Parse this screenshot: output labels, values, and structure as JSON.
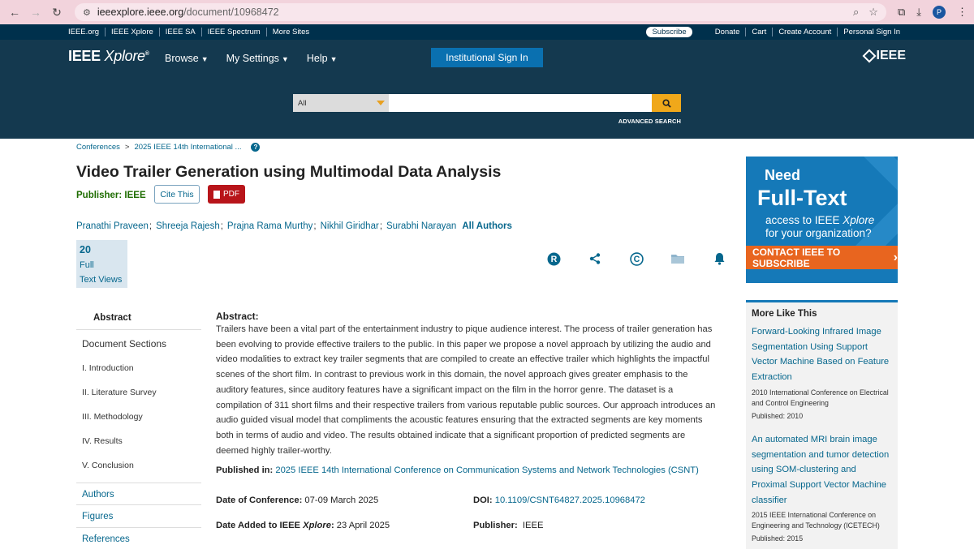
{
  "browser": {
    "url_host": "ieeexplore.ieee.org",
    "url_path": "/document/10968472",
    "profile_initial": "P"
  },
  "meta_bar": {
    "left_links": [
      "IEEE.org",
      "IEEE Xplore",
      "IEEE SA",
      "IEEE Spectrum",
      "More Sites"
    ],
    "subscribe": "Subscribe",
    "right_links": [
      "Donate",
      "Cart",
      "Create Account",
      "Personal Sign In"
    ]
  },
  "header": {
    "logo_ieee": "IEEE",
    "logo_xplore": "Xplore",
    "logo_mark": "®",
    "nav": [
      "Browse",
      "My Settings",
      "Help"
    ],
    "institutional_sign_in": "Institutional Sign In",
    "ieee_mark": "IEEE",
    "search_scope": "All",
    "search_placeholder": "",
    "advanced_search": "ADVANCED SEARCH"
  },
  "breadcrumb": [
    "Conferences",
    "2025 IEEE 14th International ..."
  ],
  "breadcrumb_sep": ">",
  "article": {
    "title": "Video Trailer Generation using Multimodal Data Analysis",
    "publisher_label": "Publisher:  IEEE",
    "cite_this": "Cite This",
    "pdf": "PDF",
    "authors": [
      "Pranathi Praveen",
      "Shreeja Rajesh",
      "Prajna Rama Murthy",
      "Nikhil Giridhar",
      "Surabhi Narayan"
    ],
    "author_sep": ";",
    "all_authors": "All Authors",
    "metrics_count": "20",
    "metrics_label_1": "Full",
    "metrics_label_2": "Text Views"
  },
  "doc_nav": {
    "abstract": "Abstract",
    "document_sections": "Document Sections",
    "sections": [
      "I.  Introduction",
      "II.  Literature Survey",
      "III.  Methodology",
      "IV.  Results",
      "V.  Conclusion"
    ],
    "links": [
      "Authors",
      "Figures",
      "References"
    ]
  },
  "abstract": {
    "label": "Abstract:",
    "text": "Trailers have been a vital part of the entertainment industry to pique audience interest. The process of trailer generation has been evolving to provide effective trailers to the public. In this paper we propose a novel approach by utilizing the audio and video modalities to extract key trailer segments that are compiled to create an effective trailer which highlights the impactful scenes of the short film. In contrast to previous work in this domain, the novel approach gives greater emphasis to the auditory features, since auditory features have a significant impact on the film in the horror genre. The dataset is a compilation of 311 short films and their respective trailers from various reputable public sources. Our approach introduces an audio guided visual model that compliments the acoustic features ensuring that the extracted segments are key moments both in terms of audio and video. The results obtained indicate that a significant proportion of predicted segments are deemed highly trailer-worthy."
  },
  "details": {
    "published_in_label": "Published in:",
    "published_in_value": "2025 IEEE 14th International Conference on Communication Systems and Network Technologies (CSNT)",
    "date_conf_label": "Date of Conference:",
    "date_conf_value": "07-09 March 2025",
    "doi_label": "DOI:",
    "doi_value": "10.1109/CSNT64827.2025.10968472",
    "date_added_label": "Date Added to IEEE ",
    "date_added_xplore": "Xplore",
    "date_added_value": "23 April 2025",
    "publisher_label": "Publisher:",
    "publisher_value": "IEEE"
  },
  "ad": {
    "need": "Need",
    "full_text": "Full-Text",
    "access_line1": "access to IEEE ",
    "access_xplore": "Xplore",
    "access_line2": "for your organization?",
    "contact": "CONTACT IEEE TO SUBSCRIBE",
    "contact_arrow": "›"
  },
  "more_like_this": {
    "heading": "More Like This",
    "items": [
      {
        "title": "Forward-Looking Infrared Image Segmentation Using Support Vector Machine Based on Feature Extraction",
        "venue": "2010 International Conference on Electrical and Control Engineering",
        "published": "Published: 2010"
      },
      {
        "title": "An automated MRI brain image segmentation and tumor detection using SOM-clustering and Proximal Support Vector Machine classifier",
        "venue": "2015 IEEE International Conference on Engineering and Technology (ICETECH)",
        "published": "Published: 2015"
      }
    ]
  },
  "colors": {
    "link": "#06678d",
    "header_bg": "#14394f",
    "meta_bar_bg": "#00304c",
    "pdf_red": "#b8151a",
    "publisher_green": "#1e6c00",
    "ad_blue": "#1579b8",
    "ad_orange": "#e8651f"
  }
}
